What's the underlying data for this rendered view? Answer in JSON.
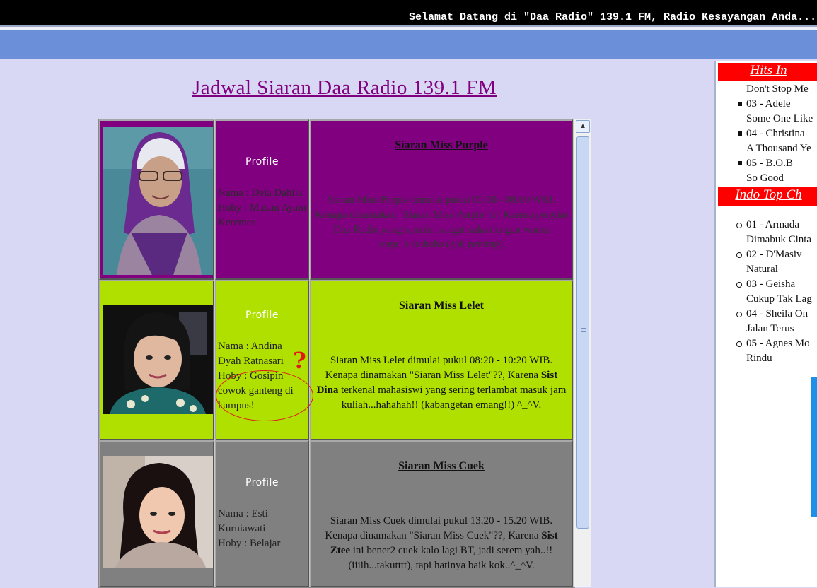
{
  "marquee": {
    "text": "Selamat Datang di \"Daa Radio\" 139.1 FM, Radio Kesayangan Anda..."
  },
  "page": {
    "title": "Jadwal Siaran Daa Radio 139.1 FM"
  },
  "schedule": [
    {
      "bg": "#800080",
      "photo_desc": "purple-hijab-photo",
      "profile_label": "Profile",
      "nama": "Nama : Dela Dahlia",
      "hoby": "Hoby : Makan Ayam Keremes",
      "title": "Siaran Miss Purple",
      "body": "Siaran Miss Purple dimulai pukul 05:00 - 08:00 WIB. Kenapa dinamakan \"Siaran Miss Purple\"??, Karena penyiar Daa Radio yang satu ini sangat suka dengan warna ungu..hahahaha (gak penting)."
    },
    {
      "bg": "#b0e000",
      "photo_desc": "miss-lelet-photo",
      "profile_label": "Profile",
      "nama": "Nama : Andina Dyah Ratnasari",
      "hoby": "Hoby : Gosipin cowok ganteng di kampus!",
      "title": "Siaran Miss Lelet",
      "body_before": "Siaran Miss Lelet dimulai pukul 08:20 - 10:20 WIB. Kenapa dinamakan \"Siaran Miss Lelet\"??, Karena ",
      "body_bold": "Sist Dina",
      "body_after": " terkenal mahasiswi yang sering terlambat masuk jam kuliah...hahahah!! (kabangetan emang!!) ^_^V."
    },
    {
      "bg": "#808080",
      "photo_desc": "miss-cuek-photo",
      "profile_label": "Profile",
      "nama": "Nama : Esti Kurniawati",
      "hoby": "Hoby : Belajar",
      "title": "Siaran Miss Cuek",
      "body_before": "Siaran Miss Cuek dimulai pukul 13.20 - 15.20 WIB. Kenapa dinamakan \"Siaran Miss Cuek\"??, Karena ",
      "body_bold": "Sist Ztee",
      "body_after": " ini bener2 cuek kalo lagi BT, jadi serem yah..!! (iiiih...takutttt), tapi hatinya baik kok..^_^V."
    }
  ],
  "annotation": {
    "qmark": "?"
  },
  "sidebar": {
    "hits_heading": "Hits In",
    "hits": [
      {
        "line1": "Don't Stop Me",
        "line2": ""
      },
      {
        "line1": "03 - Adele",
        "line2": "Some One Like"
      },
      {
        "line1": "04 - Christina",
        "line2": "A Thousand Ye"
      },
      {
        "line1": "05 - B.O.B",
        "line2": "So Good"
      }
    ],
    "indo_heading": "Indo Top Ch",
    "indo": [
      {
        "line1": "01 - Armada",
        "line2": "Dimabuk Cinta"
      },
      {
        "line1": "02 - D'Masiv",
        "line2": "Natural"
      },
      {
        "line1": "03 - Geisha",
        "line2": "Cukup Tak Lag"
      },
      {
        "line1": "04 - Sheila On",
        "line2": "Jalan Terus"
      },
      {
        "line1": "05 - Agnes Mo",
        "line2": "Rindu"
      }
    ]
  }
}
